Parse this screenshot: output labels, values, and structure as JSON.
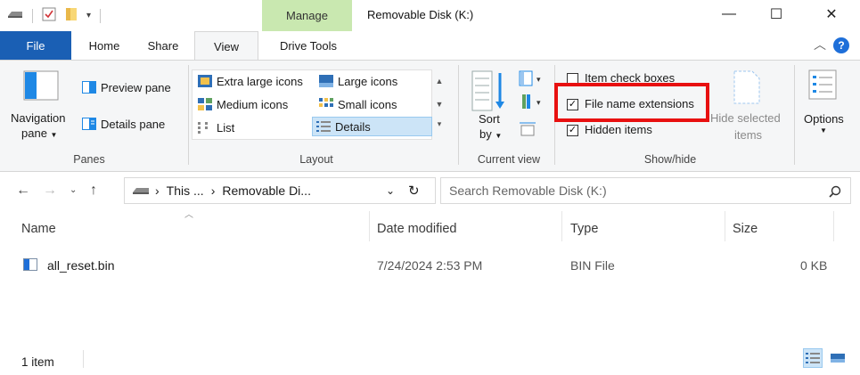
{
  "titlebar": {
    "title": "Removable Disk (K:)",
    "manage_tab": "Manage",
    "minimize": "—",
    "maximize": "☐",
    "close": "✕"
  },
  "tabs": {
    "file": "File",
    "home": "Home",
    "share": "Share",
    "view": "View",
    "drive_tools": "Drive Tools",
    "collapse": "^",
    "help": "?"
  },
  "panes": {
    "navigation_pane_line1": "Navigation",
    "navigation_pane_line2": "pane",
    "preview_pane": "Preview pane",
    "details_pane": "Details pane",
    "group_label": "Panes"
  },
  "layout": {
    "extra_large_icons": "Extra large icons",
    "large_icons": "Large icons",
    "medium_icons": "Medium icons",
    "small_icons": "Small icons",
    "list": "List",
    "details": "Details",
    "group_label": "Layout",
    "selected": "Details"
  },
  "current_view": {
    "sort_line1": "Sort",
    "sort_line2": "by",
    "group_label": "Current view"
  },
  "show_hide": {
    "item_check_boxes": "Item check boxes",
    "item_check_boxes_checked": false,
    "file_name_extensions": "File name extensions",
    "file_name_extensions_checked": true,
    "hidden_items": "Hidden items",
    "hidden_items_checked": true,
    "hide_selected_line1": "Hide selected",
    "hide_selected_line2": "items",
    "group_label": "Show/hide",
    "highlight_color": "#e81010"
  },
  "options": {
    "label": "Options"
  },
  "address": {
    "crumb1": "This ...",
    "crumb2": "Removable Di...",
    "search_placeholder": "Search Removable Disk (K:)"
  },
  "columns": {
    "name": "Name",
    "date_modified": "Date modified",
    "type": "Type",
    "size": "Size"
  },
  "files": [
    {
      "name": "all_reset.bin",
      "date": "7/24/2024 2:53 PM",
      "type": "BIN File",
      "size": "0 KB"
    }
  ],
  "status": {
    "count": "1 item"
  },
  "colors": {
    "file_tab": "#1a5fb4",
    "manage_tab": "#c9e8b0",
    "selection": "#cce4f7"
  }
}
